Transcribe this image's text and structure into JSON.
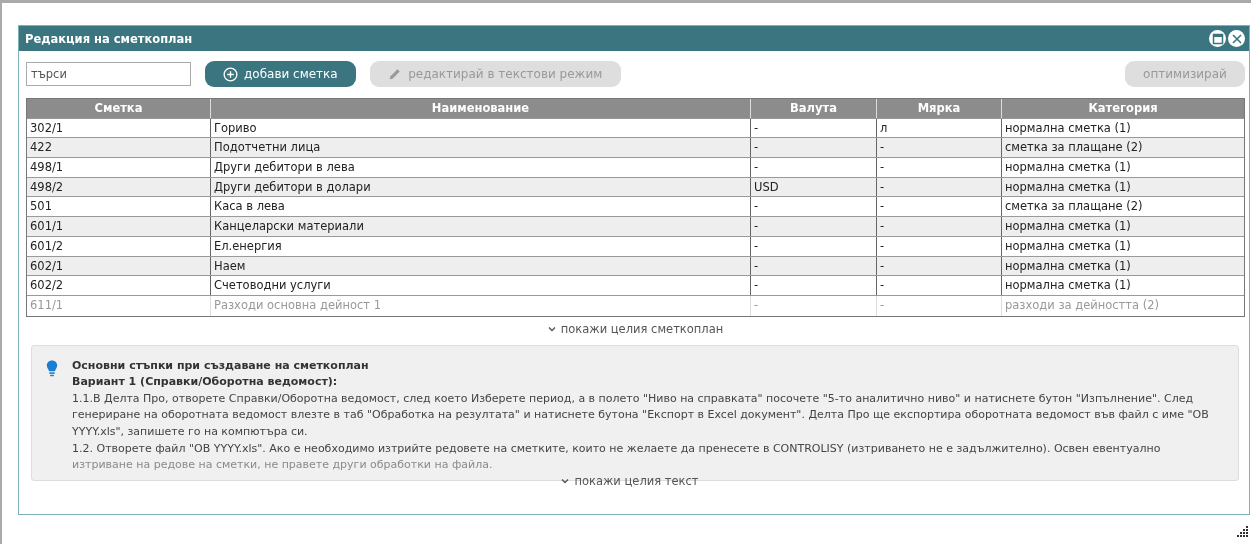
{
  "window": {
    "title": "Редакция на сметкоплан"
  },
  "search": {
    "placeholder": "търси"
  },
  "buttons": [
    {
      "label": "добави сметка",
      "kind": "add",
      "disabled": false
    },
    {
      "label": "редактирай в текстови режим",
      "kind": "edit",
      "disabled": true
    },
    {
      "label": "оптимизирай",
      "kind": "plain",
      "disabled": true
    }
  ],
  "table": {
    "columns": [
      "Сметка",
      "Наименование",
      "Валута",
      "Мярка",
      "Категория"
    ],
    "rows": [
      [
        "302/1",
        "Гориво",
        "-",
        "л",
        "нормална сметка (1)"
      ],
      [
        "422",
        "Подотчетни лица",
        "-",
        "-",
        "сметка за плащане (2)"
      ],
      [
        "498/1",
        "Други дебитори в лева",
        "-",
        "-",
        "нормална сметка (1)"
      ],
      [
        "498/2",
        "Други дебитори в долари",
        "USD",
        "-",
        "нормална сметка (1)"
      ],
      [
        "501",
        "Каса в лева",
        "-",
        "-",
        "сметка за плащане (2)"
      ],
      [
        "601/1",
        "Канцеларски материали",
        "-",
        "-",
        "нормална сметка (1)"
      ],
      [
        "601/2",
        "Ел.енергия",
        "-",
        "-",
        "нормална сметка (1)"
      ],
      [
        "602/1",
        "Наем",
        "-",
        "-",
        "нормална сметка (1)"
      ],
      [
        "602/2",
        "Счетоводни услуги",
        "-",
        "-",
        "нормална сметка (1)"
      ]
    ],
    "faded_row": [
      "611/1",
      "Разходи основна дейност 1",
      "-",
      "-",
      "разходи за дейността (2)"
    ]
  },
  "show_all_plan": "покажи целия сметкоплан",
  "info": {
    "heading": "Основни стъпки при създаване на сметкоплан",
    "subheading": "Вариант 1 (Справки/Оборотна ведомост):",
    "paragraphs": [
      "1.1.В Делта Про, отворете Справки/Оборотна ведомост, след което Изберете период, а в полето \"Ниво на справката\" посочете \"5-то аналитично ниво\" и натиснете бутон \"Изпълнение\". След генериране на оборотната ведомост влезте в таб \"Обработка на резултата\" и натиснете бутона \"Експорт в Excel документ\". Делта Про ще експортира оборотната ведомост във файл с име \"ОВ YYYY.xls\", запишете го на компютъра си.",
      "1.2. Отворете файл \"ОВ YYYY.xls\". Ако е необходимо изтрийте редовете на сметките, които не желаете да пренесете в CONTROLISY (изтриването не е задължително). Освен евентуално"
    ],
    "faded_paragraph": "изтриване на редове на сметки, не правете други обработки на файла.",
    "show_all": "покажи целия текст"
  }
}
